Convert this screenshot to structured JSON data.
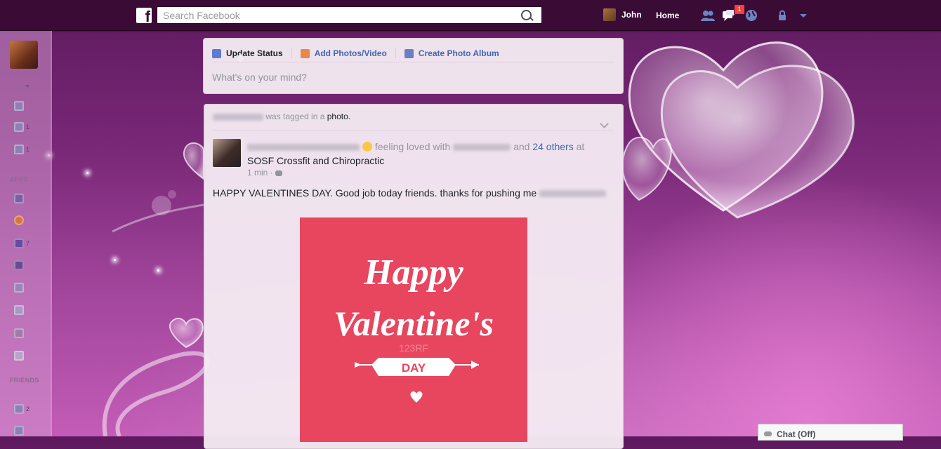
{
  "topbar": {
    "logo": "f",
    "search_placeholder": "Search Facebook",
    "user_name": "John",
    "home_label": "Home",
    "notification_count": "1"
  },
  "leftrail": {
    "items": [
      {
        "icon": "news-feed-icon",
        "count": ""
      },
      {
        "icon": "messages-icon",
        "count": "1"
      },
      {
        "icon": "events-icon",
        "count": "1"
      }
    ],
    "apps_header": "APPS",
    "apps": [
      {
        "icon": "games-icon",
        "count": ""
      },
      {
        "icon": "app-circle-icon",
        "count": ""
      },
      {
        "icon": "app-heart-icon",
        "count": "7"
      },
      {
        "icon": "app-check-icon",
        "count": ""
      },
      {
        "icon": "bookmark-icon",
        "count": ""
      },
      {
        "icon": "pages-feed-icon",
        "count": ""
      },
      {
        "icon": "photos-icon",
        "count": ""
      },
      {
        "icon": "game-controller-icon",
        "count": ""
      }
    ],
    "friends_header": "FRIENDS",
    "friends": [
      {
        "icon": "friends-list-icon",
        "count": "2"
      },
      {
        "icon": "nearby-friends-icon",
        "count": ""
      }
    ]
  },
  "composer": {
    "tabs": [
      "Update Status",
      "Add Photos/Video",
      "Create Photo Album"
    ],
    "placeholder": "What's on your mind?"
  },
  "post": {
    "tagged_text": "was tagged in a",
    "tagged_link": "photo",
    "feeling_text": "feeling loved with",
    "and_text": "and",
    "others_link": "24 others",
    "at_text": "at",
    "place": "SOSF Crossfit and Chiropractic",
    "time": "1 min",
    "body": "HAPPY VALENTINES DAY. Good job today friends. thanks for pushing me",
    "photo": {
      "line1": "Happy",
      "line2": "Valentine's",
      "ribbon": "DAY",
      "watermark": "123RF",
      "background_color": "#e8455f"
    }
  },
  "chat": {
    "label": "Chat (Off)"
  }
}
